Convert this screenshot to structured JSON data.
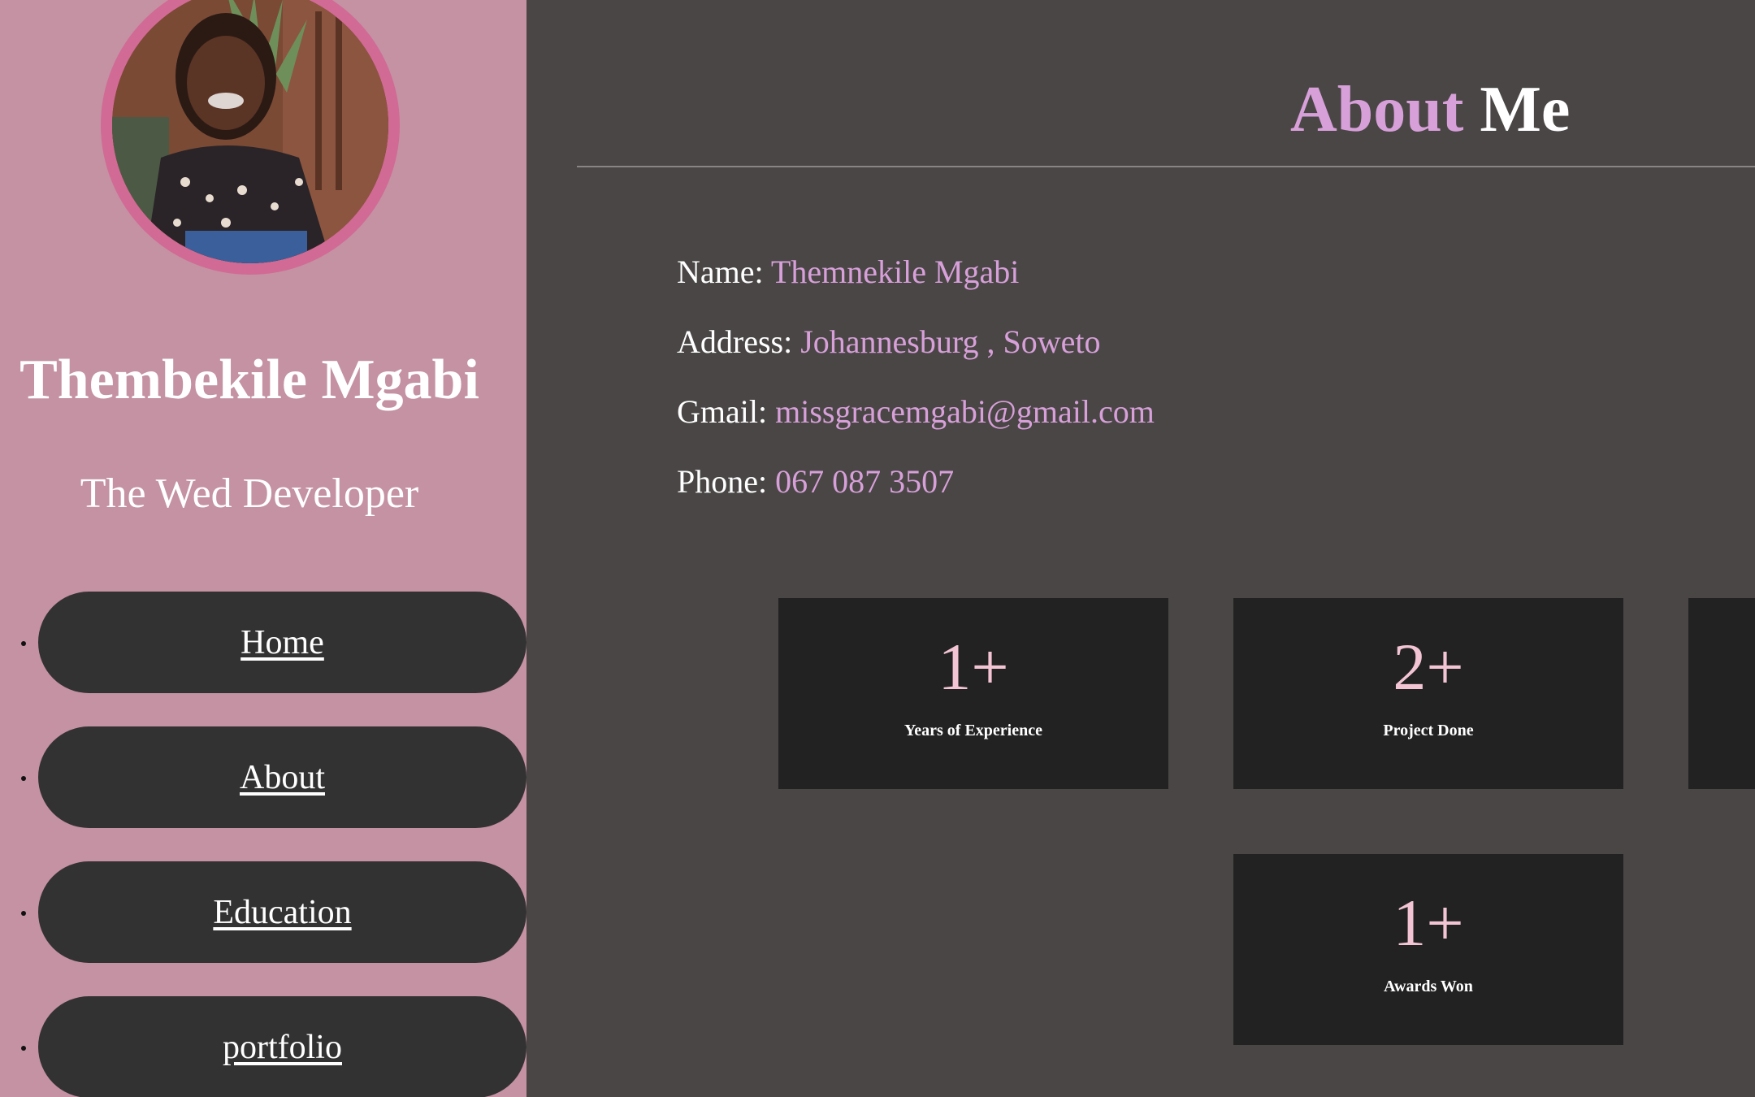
{
  "colors": {
    "sidebar_bg": "#c492a2",
    "main_bg": "#4a4646",
    "accent": "#d7a0d9",
    "nav_pill": "#333232",
    "card_bg": "#222222",
    "stat_number": "#f2c4d4",
    "avatar_ring": "#d16a94"
  },
  "sidebar": {
    "avatar": {
      "icon": "profile-photo"
    },
    "name": "Thembekile Mgabi",
    "role": "The Wed Developer",
    "nav": [
      {
        "label": "Home"
      },
      {
        "label": "About"
      },
      {
        "label": "Education"
      },
      {
        "label": "portfolio"
      }
    ]
  },
  "main": {
    "title_accent": "About",
    "title_rest": "Me",
    "info": [
      {
        "label": "Name:",
        "value": "Themnekile Mgabi"
      },
      {
        "label": "Address:",
        "value": "Johannesburg , Soweto"
      },
      {
        "label": "Gmail:",
        "value": "missgracemgabi@gmail.com"
      },
      {
        "label": "Phone:",
        "value": "067 087 3507"
      }
    ],
    "stats": [
      {
        "number": "1+",
        "label": "Years of Experience"
      },
      {
        "number": "2+",
        "label": "Project Done"
      },
      {
        "number": "",
        "label": ""
      },
      {
        "number": "1+",
        "label": "Awards Won"
      }
    ]
  }
}
